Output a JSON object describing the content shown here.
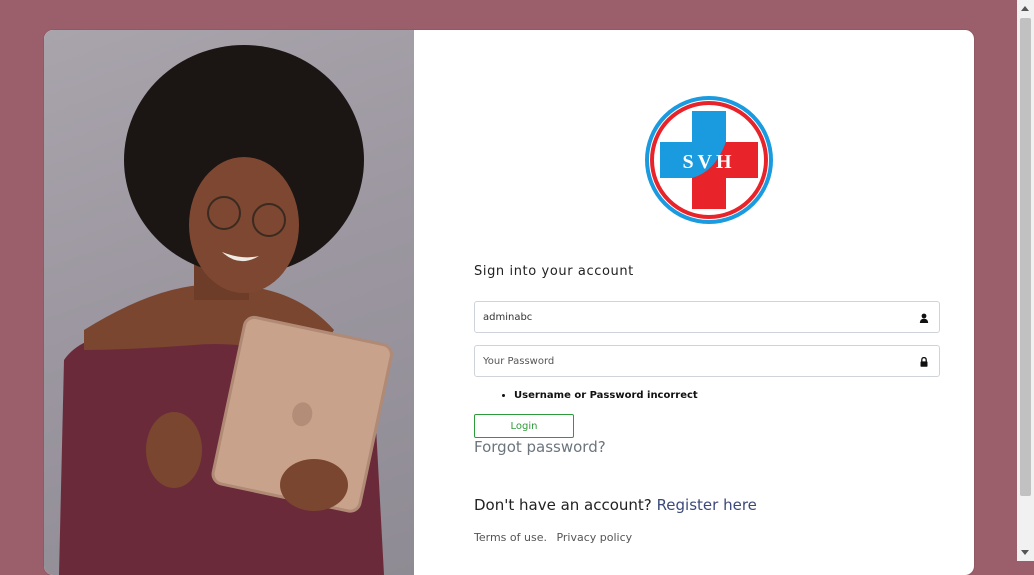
{
  "logo": {
    "text": "SVH",
    "colors": {
      "blue": "#1a9be0",
      "red": "#e8232a",
      "ring": "#e8232a"
    }
  },
  "form": {
    "heading": "Sign into your account",
    "username": {
      "value": "adminabc",
      "icon": "user-icon"
    },
    "password": {
      "value": "",
      "placeholder": "Your Password",
      "icon": "lock-icon"
    },
    "errors": [
      "Username or Password incorrect"
    ],
    "login_label": "Login",
    "forgot_label": "Forgot password?",
    "register_prompt": "Don't have an account?",
    "register_link": "Register here",
    "terms_label": "Terms of use.",
    "privacy_label": "Privacy policy"
  },
  "colors": {
    "background": "#9a5f6a",
    "login_accent": "#2e9b3a",
    "link": "#3b4a7a"
  }
}
